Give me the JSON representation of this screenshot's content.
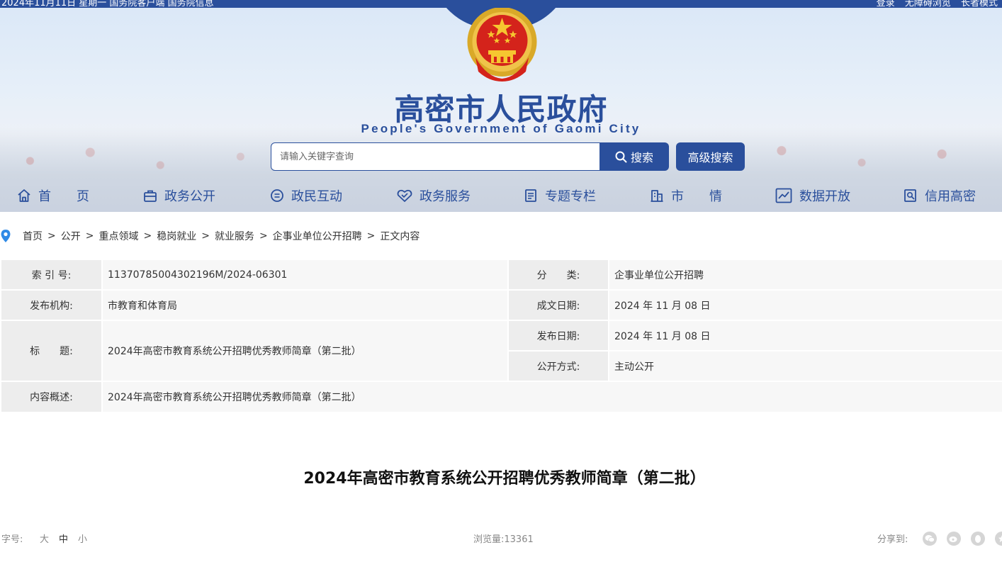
{
  "topbar": {
    "left_text": "2024年11月11日 星期一  国务院客户端  国务院信息",
    "login": "登录",
    "accessibility": "无障碍浏览",
    "elder": "长者模式"
  },
  "header": {
    "title": "高密市人民政府",
    "subtitle": "People's Government of Gaomi City",
    "search_placeholder": "请输入关键字查询",
    "search_button": "搜索",
    "advanced_search_button": "高级搜索"
  },
  "nav": [
    {
      "label": "首　　页",
      "icon": "home-icon"
    },
    {
      "label": "政务公开",
      "icon": "briefcase-icon"
    },
    {
      "label": "政民互动",
      "icon": "chat-icon"
    },
    {
      "label": "政务服务",
      "icon": "handshake-icon"
    },
    {
      "label": "专题专栏",
      "icon": "document-icon"
    },
    {
      "label": "市　　情",
      "icon": "building-icon"
    },
    {
      "label": "数据开放",
      "icon": "chart-icon"
    },
    {
      "label": "信用高密",
      "icon": "credit-icon"
    }
  ],
  "breadcrumb": [
    "首页",
    "公开",
    "重点领域",
    "稳岗就业",
    "就业服务",
    "企事业单位公开招聘",
    "正文内容"
  ],
  "breadcrumb_sep": ">",
  "info": {
    "index_label": "索 引 号:",
    "index_value": "11370785004302196M/2024-06301",
    "category_label": "分　　类:",
    "category_value": "企事业单位公开招聘",
    "publisher_label": "发布机构:",
    "publisher_value": "市教育和体育局",
    "created_label": "成文日期:",
    "created_value": "2024 年 11 月 08 日",
    "title_label": "标　　题:",
    "title_value": "2024年高密市教育系统公开招聘优秀教师简章（第二批）",
    "published_label": "发布日期:",
    "published_value": "2024 年 11 月 08 日",
    "open_label": "公开方式:",
    "open_value": "主动公开",
    "summary_label": "内容概述:",
    "summary_value": "2024年高密市教育系统公开招聘优秀教师简章（第二批）"
  },
  "article": {
    "title": "2024年高密市教育系统公开招聘优秀教师简章（第二批）"
  },
  "footer": {
    "font_size_label": "字号:",
    "font_large": "大",
    "font_medium": "中",
    "font_small": "小",
    "views_label": "浏览量:",
    "views": "13361",
    "share_label": "分享到:"
  },
  "colors": {
    "brand": "#2a4f9c",
    "label_bg": "#ededed",
    "value_bg": "#f7f7f7"
  }
}
